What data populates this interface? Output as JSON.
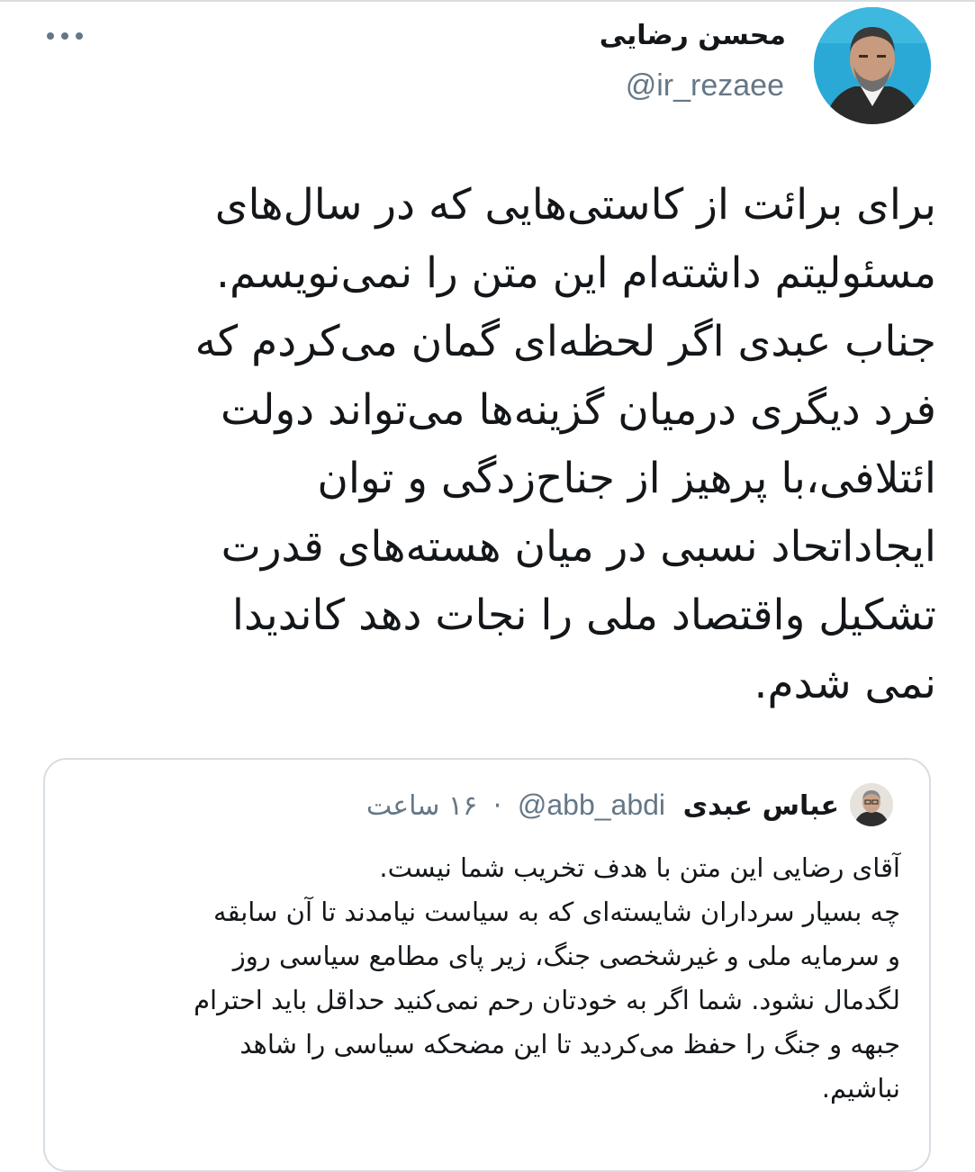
{
  "tweet": {
    "author_name": "محسن رضایی",
    "author_handle": "@ir_rezaee",
    "body_lines": [
      "برای برائت از کاستی‌هایی که در سال‌های",
      "مسئولیتم داشته‌ام این متن را نمی‌نویسم.",
      "جناب عبدی  اگر لحظه‌ای گمان می‌کردم که",
      "فرد دیگری درمیان گزینه‌ها می‌تواند دولت",
      "ائتلافی،با پرهیز از جناح‌زدگی و توان",
      "ایجاداتحاد نسبی در میان هسته‌های قدرت",
      "تشکیل واقتصاد ملی را نجات دهد کاندیدا",
      "نمی شدم."
    ]
  },
  "quoted_tweet": {
    "author_name": "عباس عبدی",
    "author_handle": "@abb_abdi",
    "separator": "·",
    "time": "۱۶ ساعت",
    "body_lines": [
      "آقای رضایی این متن با هدف تخریب شما نیست.",
      "چه بسیار سرداران شایسته‌ای که به سیاست نیامدند تا آن سابقه",
      "و سرمایه ملی و غیرشخصی جنگ، زیر پای مطامع سیاسی روز",
      "لگدمال نشود. شما اگر به خودتان رحم نمی‌کنید حداقل باید احترام",
      "جبهه و جنگ را حفظ می‌کردید تا این مضحکه سیاسی را شاهد",
      "نباشیم."
    ]
  },
  "icons": {
    "more": "more-options-icon"
  },
  "colors": {
    "text": "#14171a",
    "secondary": "#657786",
    "border": "#d6dde3",
    "avatar_bg": "#2aa9d6"
  }
}
